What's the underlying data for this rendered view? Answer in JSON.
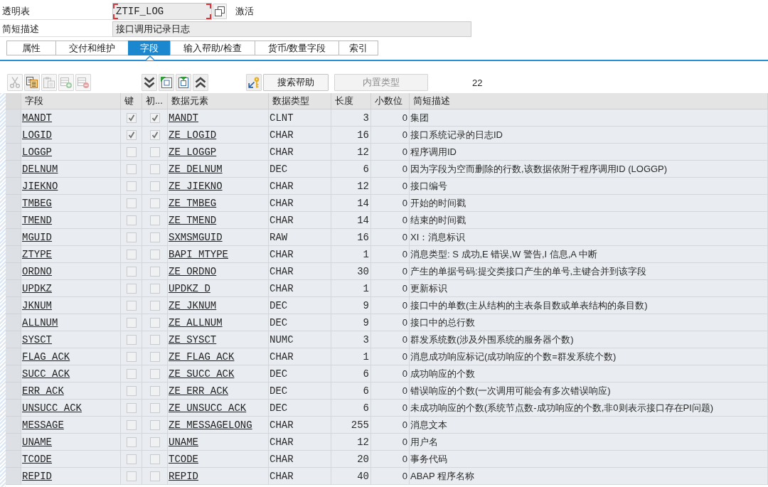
{
  "header": {
    "type_label": "透明表",
    "table_name": {
      "value": "ZTIF_LOG",
      "focused": true
    },
    "status": "激活",
    "description_label": "简短描述",
    "description": "接口调用记录日志"
  },
  "tabs": [
    {
      "label": "属性",
      "selected": false
    },
    {
      "label": "交付和维护",
      "selected": false
    },
    {
      "label": "字段",
      "selected": true
    },
    {
      "label": "输入帮助/检查",
      "selected": false
    },
    {
      "label": "货币/数量字段",
      "selected": false
    },
    {
      "label": "索引",
      "selected": false
    }
  ],
  "toolbar": {
    "icon_groups": [
      {
        "buttons": [
          {
            "kind": "cut",
            "disabled": true
          },
          {
            "kind": "copy",
            "disabled": false
          },
          {
            "kind": "paste",
            "disabled": true
          },
          {
            "kind": "insert_row",
            "disabled": true
          },
          {
            "kind": "delete_row",
            "disabled": true
          }
        ]
      },
      {
        "buttons": [
          {
            "kind": "chevrons_down",
            "disabled": false
          },
          {
            "kind": "square_flag_left",
            "disabled": false
          },
          {
            "kind": "square_flag_top",
            "disabled": false
          },
          {
            "kind": "chevrons_up",
            "disabled": false
          }
        ]
      },
      {
        "buttons": [
          {
            "kind": "key_arrow",
            "disabled": false
          }
        ]
      }
    ],
    "search_help_button": "搜索帮助",
    "builtin_type_button": {
      "label": "内置类型",
      "disabled": true
    },
    "count": "22"
  },
  "table": {
    "columns": [
      "字段",
      "键",
      "初...",
      "数据元素",
      "数据类型",
      "长度",
      "小数位",
      "简短描述"
    ],
    "rows": [
      {
        "field": "MANDT",
        "key_checked": true,
        "column_3_checked": true,
        "data_element": "MANDT",
        "data_type": "CLNT",
        "length": "3",
        "decimals": "0",
        "description": "集团"
      },
      {
        "field": "LOGID",
        "key_checked": true,
        "column_3_checked": true,
        "data_element": "ZE_LOGID",
        "data_type": "CHAR",
        "length": "16",
        "decimals": "0",
        "description": "接口系统记录的日志ID"
      },
      {
        "field": "LOGGP",
        "key_checked": false,
        "column_3_checked": false,
        "data_element": "ZE_LOGGP",
        "data_type": "CHAR",
        "length": "12",
        "decimals": "0",
        "description": "程序调用ID"
      },
      {
        "field": "DELNUM",
        "key_checked": false,
        "column_3_checked": false,
        "data_element": "ZE_DELNUM",
        "data_type": "DEC",
        "length": "6",
        "decimals": "0",
        "description": "因为字段为空而删除的行数,该数据依附于程序调用ID (LOGGP)"
      },
      {
        "field": "JIEKNO",
        "key_checked": false,
        "column_3_checked": false,
        "data_element": "ZE_JIEKNO",
        "data_type": "CHAR",
        "length": "12",
        "decimals": "0",
        "description": "接口编号"
      },
      {
        "field": "TMBEG",
        "key_checked": false,
        "column_3_checked": false,
        "data_element": "ZE_TMBEG",
        "data_type": "CHAR",
        "length": "14",
        "decimals": "0",
        "description": "开始的时间戳"
      },
      {
        "field": "TMEND",
        "key_checked": false,
        "column_3_checked": false,
        "data_element": "ZE_TMEND",
        "data_type": "CHAR",
        "length": "14",
        "decimals": "0",
        "description": "结束的时间戳"
      },
      {
        "field": "MGUID",
        "key_checked": false,
        "column_3_checked": false,
        "data_element": "SXMSMGUID",
        "data_type": "RAW",
        "length": "16",
        "decimals": "0",
        "description": "XI：消息标识"
      },
      {
        "field": "ZTYPE",
        "key_checked": false,
        "column_3_checked": false,
        "data_element": "BAPI_MTYPE",
        "data_type": "CHAR",
        "length": "1",
        "decimals": "0",
        "description": "消息类型: S 成功,E 错误,W 警告,I 信息,A 中断"
      },
      {
        "field": "ORDNO",
        "key_checked": false,
        "column_3_checked": false,
        "data_element": "ZE_ORDNO",
        "data_type": "CHAR",
        "length": "30",
        "decimals": "0",
        "description": "产生的单据号码:提交类接口产生的单号,主键合并到该字段"
      },
      {
        "field": "UPDKZ",
        "key_checked": false,
        "column_3_checked": false,
        "data_element": "UPDKZ_D",
        "data_type": "CHAR",
        "length": "1",
        "decimals": "0",
        "description": "更新标识"
      },
      {
        "field": "JKNUM",
        "key_checked": false,
        "column_3_checked": false,
        "data_element": "ZE_JKNUM",
        "data_type": "DEC",
        "length": "9",
        "decimals": "0",
        "description": "接口中的单数(主从结构的主表条目数或单表结构的条目数)"
      },
      {
        "field": "ALLNUM",
        "key_checked": false,
        "column_3_checked": false,
        "data_element": "ZE_ALLNUM",
        "data_type": "DEC",
        "length": "9",
        "decimals": "0",
        "description": "接口中的总行数"
      },
      {
        "field": "SYSCT",
        "key_checked": false,
        "column_3_checked": false,
        "data_element": "ZE_SYSCT",
        "data_type": "NUMC",
        "length": "3",
        "decimals": "0",
        "description": "群发系统数(涉及外围系统的服务器个数)"
      },
      {
        "field": "FLAG_ACK",
        "key_checked": false,
        "column_3_checked": false,
        "data_element": "ZE_FLAG_ACK",
        "data_type": "CHAR",
        "length": "1",
        "decimals": "0",
        "description": "消息成功响应标记(成功响应的个数=群发系统个数)"
      },
      {
        "field": "SUCC_ACK",
        "key_checked": false,
        "column_3_checked": false,
        "data_element": "ZE_SUCC_ACK",
        "data_type": "DEC",
        "length": "6",
        "decimals": "0",
        "description": "成功响应的个数"
      },
      {
        "field": "ERR_ACK",
        "key_checked": false,
        "column_3_checked": false,
        "data_element": "ZE_ERR_ACK",
        "data_type": "DEC",
        "length": "6",
        "decimals": "0",
        "description": "错误响应的个数(一次调用可能会有多次错误响应)"
      },
      {
        "field": "UNSUCC_ACK",
        "key_checked": false,
        "column_3_checked": false,
        "data_element": "ZE_UNSUCC_ACK",
        "data_type": "DEC",
        "length": "6",
        "decimals": "0",
        "description": "未成功响应的个数(系统节点数-成功响应的个数,非0则表示接口存在PI问题)"
      },
      {
        "field": "MESSAGE",
        "key_checked": false,
        "column_3_checked": false,
        "data_element": "ZE_MESSAGELONG",
        "data_type": "CHAR",
        "length": "255",
        "decimals": "0",
        "description": "消息文本"
      },
      {
        "field": "UNAME",
        "key_checked": false,
        "column_3_checked": false,
        "data_element": "UNAME",
        "data_type": "CHAR",
        "length": "12",
        "decimals": "0",
        "description": "用户名"
      },
      {
        "field": "TCODE",
        "key_checked": false,
        "column_3_checked": false,
        "data_element": "TCODE",
        "data_type": "CHAR",
        "length": "20",
        "decimals": "0",
        "description": "事务代码"
      },
      {
        "field": "REPID",
        "key_checked": false,
        "column_3_checked": false,
        "data_element": "REPID",
        "data_type": "CHAR",
        "length": "40",
        "decimals": "0",
        "description": "ABAP 程序名称"
      }
    ]
  }
}
